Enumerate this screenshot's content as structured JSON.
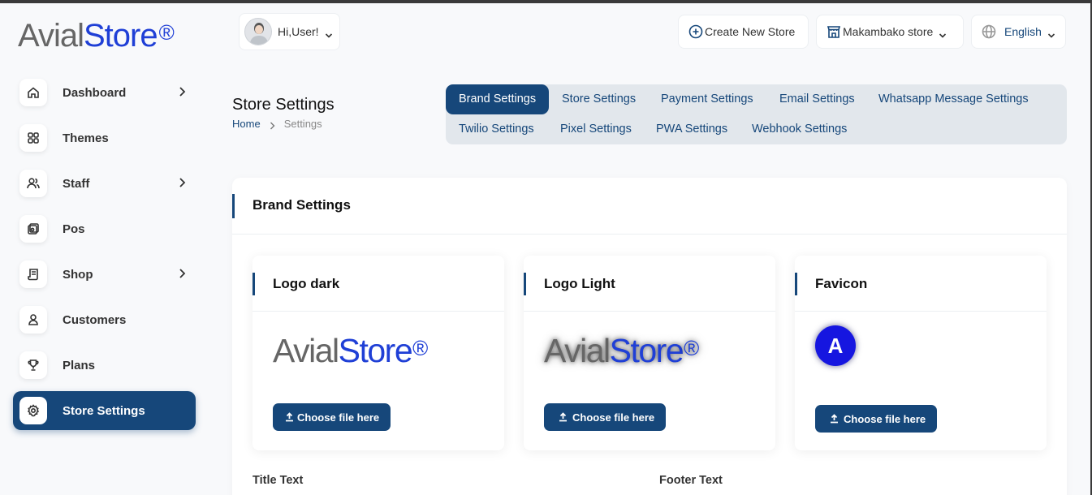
{
  "brand": {
    "name_part1": "Avial",
    "name_part2": "Store",
    "mark": "®"
  },
  "sidebar": {
    "items": [
      {
        "label": "Dashboard",
        "icon": "home-icon",
        "has_chevron": true
      },
      {
        "label": "Themes",
        "icon": "grid-icon",
        "has_chevron": false
      },
      {
        "label": "Staff",
        "icon": "users-icon",
        "has_chevron": true
      },
      {
        "label": "Pos",
        "icon": "pos-icon",
        "has_chevron": false
      },
      {
        "label": "Shop",
        "icon": "shop-icon",
        "has_chevron": true
      },
      {
        "label": "Customers",
        "icon": "user-icon",
        "has_chevron": false
      },
      {
        "label": "Plans",
        "icon": "trophy-icon",
        "has_chevron": false
      },
      {
        "label": "Store Settings",
        "icon": "gear-icon",
        "has_chevron": false,
        "active": true
      }
    ]
  },
  "header": {
    "user_greeting": "Hi,User!",
    "create_store": "Create New Store",
    "store_name": "Makambako store",
    "language": "English"
  },
  "page": {
    "title": "Store Settings",
    "breadcrumb": {
      "home": "Home",
      "current": "Settings"
    }
  },
  "tabs": [
    {
      "label": "Brand Settings",
      "active": true
    },
    {
      "label": "Store Settings"
    },
    {
      "label": "Payment Settings"
    },
    {
      "label": "Email Settings"
    },
    {
      "label": "Whatsapp Message Settings"
    },
    {
      "label": "Twilio Settings"
    },
    {
      "label": "Pixel Settings"
    },
    {
      "label": "PWA Settings"
    },
    {
      "label": "Webhook Settings"
    }
  ],
  "brand_settings": {
    "title": "Brand Settings",
    "logo_dark": {
      "title": "Logo dark",
      "button": "Choose file here"
    },
    "logo_light": {
      "title": "Logo Light",
      "button": "Choose file here"
    },
    "favicon": {
      "title": "Favicon",
      "letter": "A",
      "button": "Choose file here"
    },
    "title_text_label": "Title Text",
    "footer_text_label": "Footer Text"
  },
  "colors": {
    "accent": "#16477a",
    "brand_blue": "#1f3fd6",
    "tab_bg": "#e2e7ec"
  }
}
